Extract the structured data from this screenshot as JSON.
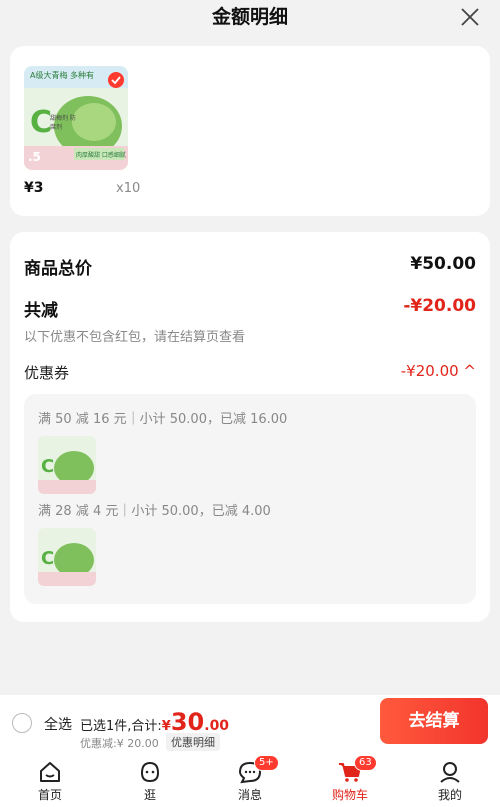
{
  "header": {
    "title": "金额明细"
  },
  "product": {
    "price": "¥3",
    "quantity": "x10",
    "image_text": {
      "top": "A级大青梅 多种有",
      "side": "甜梅剂 防腐剂",
      "bottom": "肉厚酸甜 口感细腻",
      "corner": ".5"
    }
  },
  "summary": {
    "total_label": "商品总价",
    "total_value": "¥50.00",
    "reduce_label": "共减",
    "reduce_value": "-¥20.00",
    "note": "以下优惠不包含红包，请在结算页查看",
    "coupon_label": "优惠券",
    "coupon_value": "-¥20.00 ^",
    "coupons": [
      {
        "text": "满 50 减 16 元｜小计 50.00，已减 16.00"
      },
      {
        "text": "满 28 减 4 元｜小计 50.00，已减 4.00"
      }
    ]
  },
  "bottom": {
    "select_all": "全选",
    "selected_text": "已选1件,合计:",
    "currency": "¥",
    "total_int": "30",
    "total_dec": ".00",
    "discount_text": "优惠减:¥ 20.00",
    "detail_tag": "优惠明细",
    "checkout": "去结算"
  },
  "tabs": [
    {
      "label": "首页",
      "icon": "home-icon"
    },
    {
      "label": "逛",
      "icon": "face-icon"
    },
    {
      "label": "消息",
      "icon": "chat-icon",
      "badge": "5+"
    },
    {
      "label": "购物车",
      "icon": "cart-icon",
      "badge": "63",
      "active": true
    },
    {
      "label": "我的",
      "icon": "profile-icon"
    }
  ],
  "colors": {
    "accent": "#e1251b",
    "background": "#f2f2f2"
  }
}
